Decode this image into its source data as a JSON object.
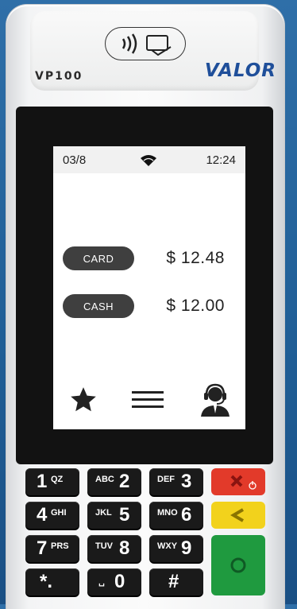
{
  "device": {
    "model": "VP100",
    "brand": "VALOR"
  },
  "status_bar": {
    "date": "03/8",
    "time": "12:24",
    "wifi_icon": "wifi-icon"
  },
  "payments": [
    {
      "label": "CARD",
      "amount": "$ 12.48"
    },
    {
      "label": "CASH",
      "amount": "$ 12.00"
    }
  ],
  "bottom_bar": {
    "icons": [
      "star-icon",
      "menu-icon",
      "support-agent-icon"
    ]
  },
  "keypad": {
    "keys": [
      {
        "main": "1",
        "sub": "QZ"
      },
      {
        "main": "2",
        "sub": "ABC"
      },
      {
        "main": "3",
        "sub": "DEF"
      },
      {
        "main": "4",
        "sub": "GHI"
      },
      {
        "main": "5",
        "sub": "JKL"
      },
      {
        "main": "6",
        "sub": "MNO"
      },
      {
        "main": "7",
        "sub": "PRS"
      },
      {
        "main": "8",
        "sub": "TUV"
      },
      {
        "main": "9",
        "sub": "WXY"
      },
      {
        "main": "*.",
        "sub": ""
      },
      {
        "main": "0",
        "sub": "␣"
      },
      {
        "main": "#",
        "sub": ""
      }
    ],
    "function_keys": {
      "cancel_color": "#e23a2a",
      "back_color": "#f2d21c",
      "enter_color": "#1f9a3f"
    }
  }
}
